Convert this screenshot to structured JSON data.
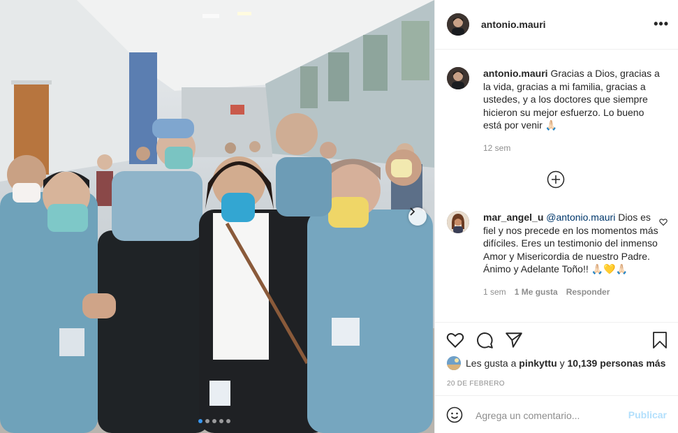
{
  "post": {
    "username": "antonio.mauri",
    "more_label": "•••",
    "photo_alt": "Hospital hallway photo with medical staff",
    "carousel_dots": 5,
    "carousel_active": 0
  },
  "caption": {
    "username": "antonio.mauri",
    "text": "Gracias a Dios, gracias a la vida, gracias a mi familia, gracias a ustedes, y a los doctores que siempre hicieron su mejor esfuerzo. Lo bueno está por venir 🙏🏻",
    "time": "12 sem"
  },
  "comment": {
    "username": "mar_angel_u",
    "mention": "@antonio.mauri",
    "text": "Dios es fiel y nos precede en los momentos más difíciles. Eres un testimonio del inmenso Amor y Misericordia de nuestro Padre. Ánimo y Adelante Toño!! 🙏🏻💛🙏🏻",
    "time": "1 sem",
    "likes": "1 Me gusta",
    "reply": "Responder"
  },
  "likes": {
    "prefix": "Les gusta a",
    "first_user": "pinkyttu",
    "connector": "y",
    "count": "10,139 personas más"
  },
  "date": "20 DE FEBRERO",
  "composer": {
    "placeholder": "Agrega un comentario...",
    "publish_label": "Publicar"
  },
  "icons": {
    "more": "more-horizontal-icon",
    "like": "heart-icon",
    "comment": "comment-icon",
    "share": "paper-plane-icon",
    "save": "bookmark-icon",
    "emoji": "smiley-icon",
    "load_more": "plus-circle-icon",
    "carousel_next": "chevron-right-icon"
  }
}
